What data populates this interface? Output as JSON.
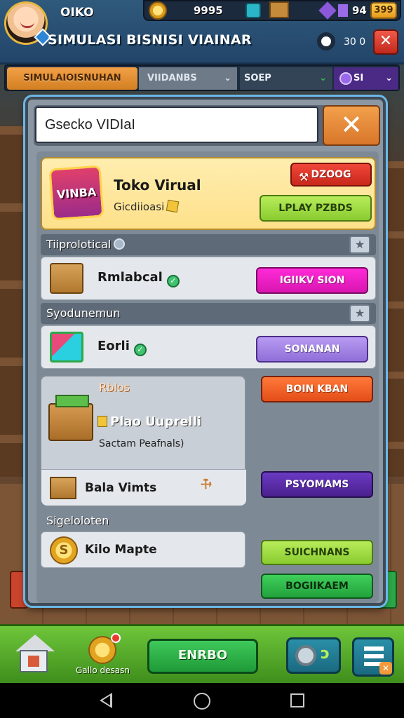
{
  "header": {
    "player_name": "OIKO",
    "game_title": "SIMULASI BISNISI VIAINAR",
    "coins": "9995",
    "gems": "94",
    "bonus_badge": "399",
    "timer": "30 0"
  },
  "tabs": [
    {
      "label": "SIMULAIOISNUHAN"
    },
    {
      "label": "VIIDANBS"
    },
    {
      "label": "SOEP"
    },
    {
      "label": "SI"
    }
  ],
  "search": {
    "value": "Gsecko VIDIaI"
  },
  "featured": {
    "title": "Toko Virual",
    "subtitle": "Gicdiioasi",
    "badge_text": "VINBA",
    "top_button": "DZOOG",
    "bottom_button": "LPLAY PZBDS"
  },
  "sections": [
    {
      "label": "Tiiprolotical"
    },
    {
      "label": "Syodunemun"
    },
    {
      "label": "Sigeloloten"
    }
  ],
  "rows": [
    {
      "title": "Rmlabcal",
      "button": "IGIIKV SION"
    },
    {
      "title": "Eorli",
      "button": "SONANAN"
    }
  ],
  "card": {
    "tag": "Rblos",
    "title": "Plao Uuprelli",
    "subtitle": "Sactam Peafnals)",
    "row_title": "Bala Vimts",
    "button_top": "BOIN KBAN",
    "button_bottom": "PSYOMAMS"
  },
  "coin_row": {
    "title": "Kilo Mapte",
    "coin_symbol": "S",
    "button_top": "SUICHNANS",
    "button_bottom": "BOGIIKAEM"
  },
  "bottom": {
    "achievement_label": "Gallo desasn",
    "main_button": "ENRBO"
  },
  "icons": {
    "close_symbol": "✕",
    "star": "★",
    "check": "✓",
    "wrench": "⚒"
  }
}
